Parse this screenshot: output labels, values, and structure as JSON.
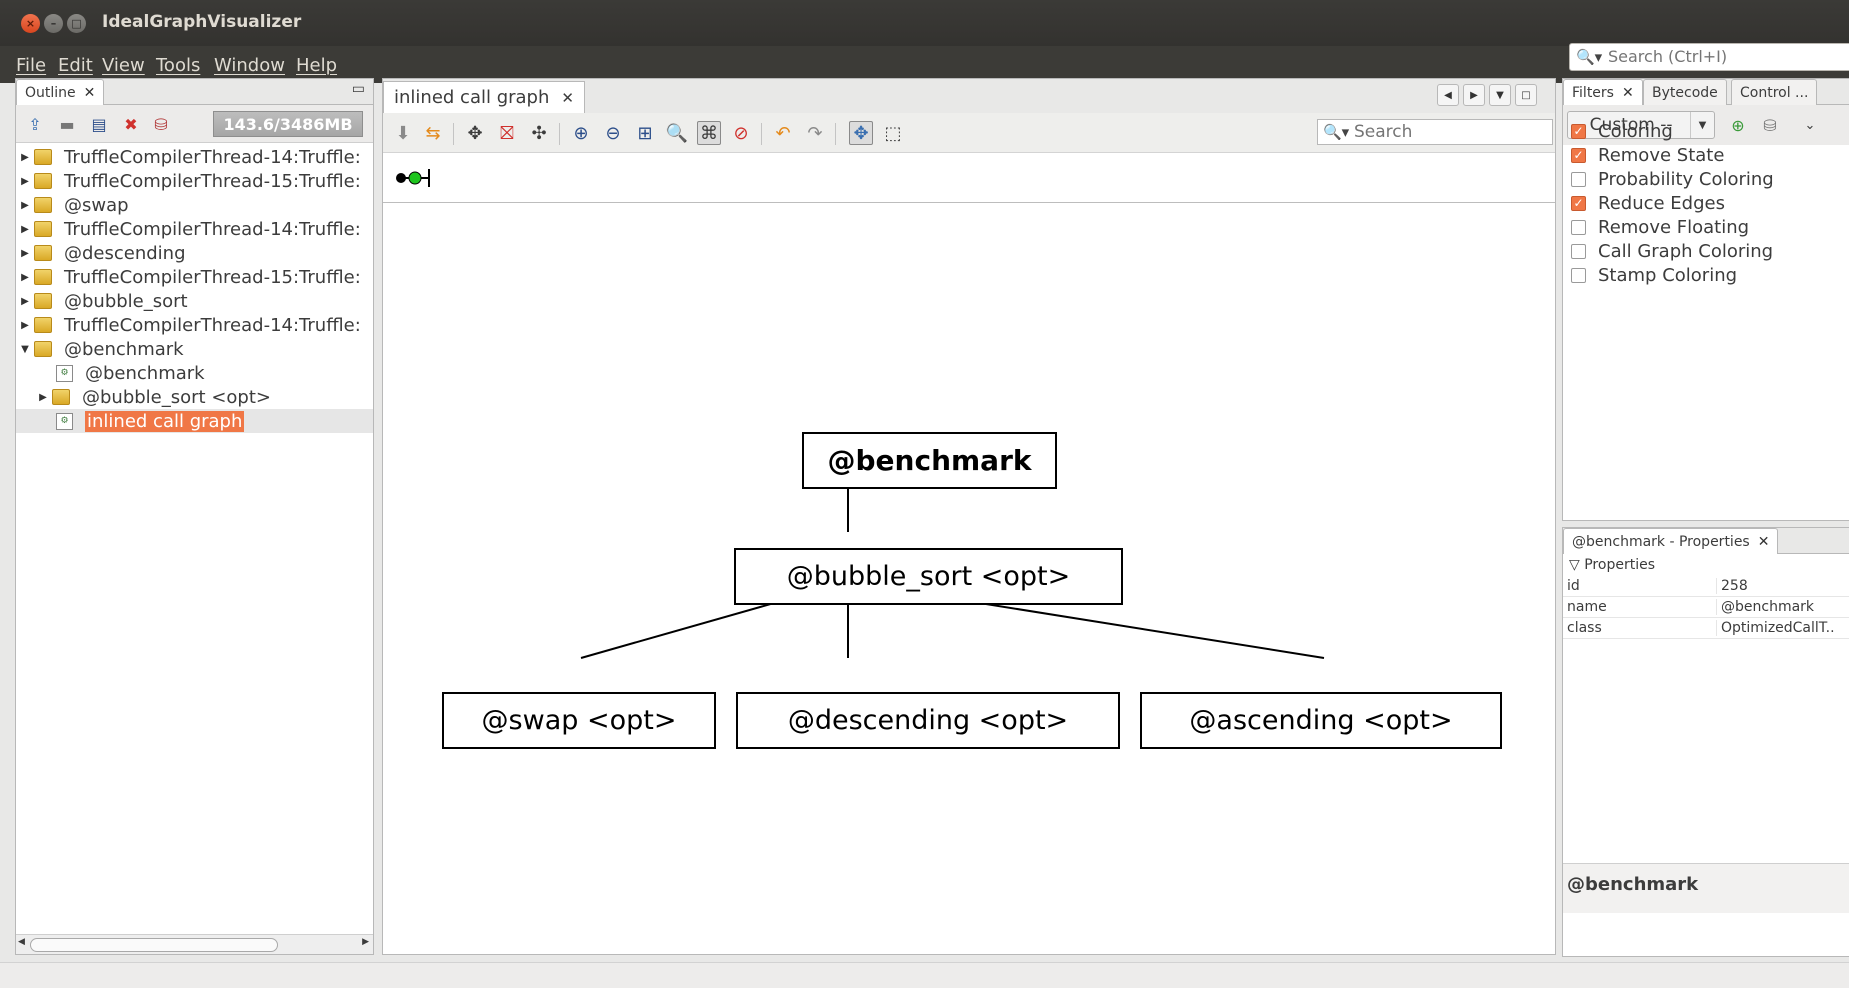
{
  "window": {
    "title": "IdealGraphVisualizer"
  },
  "menu": [
    "File",
    "Edit",
    "View",
    "Tools",
    "Window",
    "Help"
  ],
  "global_search": {
    "placeholder": "Search (Ctrl+I)"
  },
  "outline": {
    "tab_label": "Outline",
    "memory": "143.6/3486MB",
    "items": [
      {
        "label": "TruffleCompilerThread-14:Truffle:",
        "type": "folder",
        "level": 0,
        "expanded": false
      },
      {
        "label": "TruffleCompilerThread-15:Truffle:",
        "type": "folder",
        "level": 0,
        "expanded": false
      },
      {
        "label": "@swap",
        "type": "folder",
        "level": 0,
        "expanded": false
      },
      {
        "label": "TruffleCompilerThread-14:Truffle:",
        "type": "folder",
        "level": 0,
        "expanded": false
      },
      {
        "label": "@descending",
        "type": "folder",
        "level": 0,
        "expanded": false
      },
      {
        "label": "TruffleCompilerThread-15:Truffle:",
        "type": "folder",
        "level": 0,
        "expanded": false
      },
      {
        "label": "@bubble_sort",
        "type": "folder",
        "level": 0,
        "expanded": false
      },
      {
        "label": "TruffleCompilerThread-14:Truffle:",
        "type": "folder",
        "level": 0,
        "expanded": false
      },
      {
        "label": "@benchmark",
        "type": "folder",
        "level": 0,
        "expanded": true
      },
      {
        "label": "@benchmark",
        "type": "graph",
        "level": 1
      },
      {
        "label": "@bubble_sort <opt>",
        "type": "folder",
        "level": 1,
        "expanded": false
      },
      {
        "label": "inlined call graph",
        "type": "graph",
        "level": 1,
        "selected": true
      }
    ]
  },
  "editor": {
    "tab_label": "inlined call graph",
    "search_placeholder": "Search",
    "nodes": {
      "root": "@benchmark",
      "mid": "@bubble_sort <opt>",
      "leaf1": "@swap <opt>",
      "leaf2": "@descending <opt>",
      "leaf3": "@ascending <opt>"
    }
  },
  "filters": {
    "tabs": [
      "Filters",
      "Bytecode",
      "Control ..."
    ],
    "profile": "-- Custom --",
    "items": [
      {
        "label": "Coloring",
        "checked": true
      },
      {
        "label": "Remove State",
        "checked": true
      },
      {
        "label": "Probability Coloring",
        "checked": false
      },
      {
        "label": "Reduce Edges",
        "checked": true
      },
      {
        "label": "Remove Floating",
        "checked": false
      },
      {
        "label": "Call Graph Coloring",
        "checked": false
      },
      {
        "label": "Stamp Coloring",
        "checked": false
      }
    ]
  },
  "properties": {
    "tab_label": "@benchmark - Properties",
    "group": "Properties",
    "rows": [
      {
        "key": "id",
        "value": "258"
      },
      {
        "key": "name",
        "value": "@benchmark"
      },
      {
        "key": "class",
        "value": "OptimizedCallT..."
      }
    ],
    "description": "@benchmark"
  },
  "colors": {
    "accent": "#f07746",
    "titlebar": "#3c3b37"
  }
}
